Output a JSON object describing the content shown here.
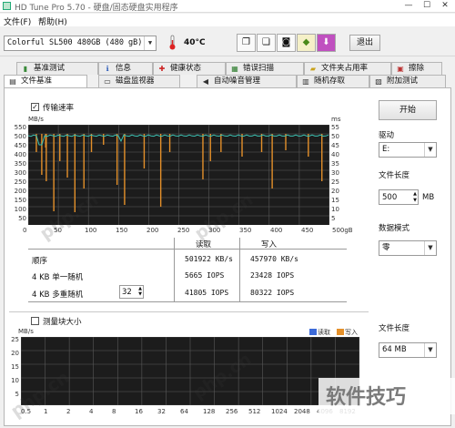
{
  "window": {
    "title": "HD Tune Pro 5.70 - 硬盘/固态硬盘实用程序",
    "min": "—",
    "max": "☐",
    "close": "✕"
  },
  "menu": [
    "文件(F)",
    "帮助(H)"
  ],
  "toolbar": {
    "drive": "Colorful SL500 480GB (480 gB)",
    "temperature": "40°C",
    "exit_label": "退出",
    "icons": [
      "copy-icon",
      "copy-info-icon",
      "screenshot-icon",
      "options-icon",
      "save-icon"
    ]
  },
  "tabs_row1": [
    {
      "label": "基准测试",
      "icon": "benchmark-icon"
    },
    {
      "label": "信息",
      "icon": "info-icon"
    },
    {
      "label": "健康状态",
      "icon": "health-icon"
    },
    {
      "label": "错误扫描",
      "icon": "error-scan-icon"
    },
    {
      "label": "文件夹占用率",
      "icon": "folder-usage-icon"
    },
    {
      "label": "擦除",
      "icon": "erase-icon"
    }
  ],
  "tabs_row2": [
    {
      "label": "文件基准",
      "icon": "file-benchmark-icon",
      "active": true
    },
    {
      "label": "磁盘监视器",
      "icon": "disk-monitor-icon",
      "active": false
    },
    {
      "label": "自动噪音管理",
      "icon": "aam-icon",
      "active": false
    },
    {
      "label": "随机存取",
      "icon": "random-access-icon",
      "active": false
    },
    {
      "label": "附加测试",
      "icon": "extra-tests-icon",
      "active": false
    }
  ],
  "transfer": {
    "checkbox_label": "传输速率",
    "checked": true
  },
  "top_chart": {
    "y_unit": "MB/s",
    "y_ticks": [
      "550",
      "500",
      "450",
      "400",
      "350",
      "300",
      "250",
      "200",
      "150",
      "100",
      "50"
    ],
    "y2_unit": "ms",
    "y2_ticks": [
      "55",
      "50",
      "45",
      "40",
      "35",
      "30",
      "25",
      "20",
      "15",
      "10",
      "5"
    ],
    "x_ticks": [
      "0",
      "50",
      "100",
      "150",
      "200",
      "250",
      "300",
      "350",
      "400",
      "450",
      "500gB"
    ]
  },
  "results": {
    "col_read": "读取",
    "col_write": "写入",
    "rows": [
      {
        "label": "顺序",
        "read": "501922 KB/s",
        "write": "457970 KB/s"
      },
      {
        "label": "4 KB 单一随机",
        "read": "5665 IOPS",
        "write": "23428 IOPS"
      },
      {
        "label": "4 KB 多重随机",
        "read": "41805 IOPS",
        "write": "80322 IOPS"
      }
    ],
    "queue_depth": "32"
  },
  "block": {
    "checkbox_label": "测量块大小",
    "checked": false
  },
  "bottom_chart": {
    "y_unit": "MB/s",
    "y_ticks": [
      "25",
      "20",
      "15",
      "10",
      "5"
    ],
    "x_ticks": [
      "0.5",
      "1",
      "2",
      "4",
      "8",
      "16",
      "32",
      "64",
      "128",
      "256",
      "512",
      "1024",
      "2048",
      "4096",
      "8192"
    ],
    "legend_read": "读取",
    "legend_write": "写入"
  },
  "side": {
    "start_label": "开始",
    "drive_label": "驱动",
    "drive_value": "E:",
    "file_length_label": "文件长度",
    "file_length_value": "500",
    "file_length_unit": "MB",
    "data_mode_label": "数据模式",
    "data_mode_value": "零",
    "file_size_label": "文件长度",
    "file_size_value": "64 MB"
  },
  "watermarks": [
    "php.cn",
    "php.cn",
    "php.cn",
    "php.cn",
    "软件技巧"
  ],
  "colors": {
    "read_line": "#3cc2b2",
    "write_spikes": "#e4902a",
    "grid": "#5a5a5a",
    "chart_bg": "#1c1c1c"
  }
}
